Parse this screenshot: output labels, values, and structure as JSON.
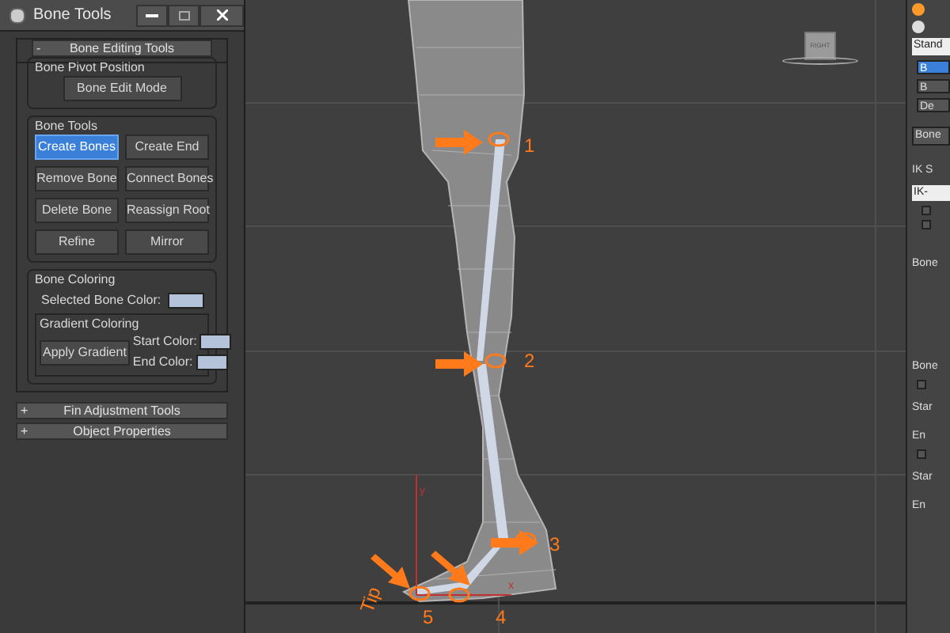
{
  "window": {
    "title": "Bone Tools"
  },
  "rollouts": [
    {
      "sign": "-",
      "title": "Bone Editing Tools"
    },
    {
      "sign": "+",
      "title": "Fin Adjustment Tools"
    },
    {
      "sign": "+",
      "title": "Object Properties"
    }
  ],
  "pivot_group": {
    "title": "Bone Pivot Position",
    "button": "Bone Edit Mode"
  },
  "bone_tools": {
    "title": "Bone Tools",
    "buttons": [
      {
        "label": "Create Bones",
        "selected": true
      },
      {
        "label": "Create End",
        "selected": false
      },
      {
        "label": "Remove Bone",
        "selected": false
      },
      {
        "label": "Connect Bones",
        "selected": false
      },
      {
        "label": "Delete Bone",
        "selected": false
      },
      {
        "label": "Reassign Root",
        "selected": false
      },
      {
        "label": "Refine",
        "selected": false
      },
      {
        "label": "Mirror",
        "selected": false
      }
    ]
  },
  "bone_coloring": {
    "title": "Bone Coloring",
    "selected_label": "Selected Bone Color:",
    "gradient": {
      "title": "Gradient Coloring",
      "button": "Apply Gradient",
      "start_label": "Start Color:",
      "end_label": "End Color:"
    }
  },
  "viewport": {
    "view_cube": "RIGHT",
    "axis_y": "y",
    "axis_x": "x",
    "annotations": [
      {
        "text": "1"
      },
      {
        "text": "2"
      },
      {
        "text": "3"
      },
      {
        "text": "Tip"
      },
      {
        "text": "5"
      },
      {
        "text": "4"
      }
    ]
  },
  "command_panel": {
    "dropdown": "Stand",
    "items": [
      {
        "label": "B",
        "selected": true
      },
      {
        "label": "B",
        "selected": false
      },
      {
        "label": "De",
        "selected": false
      }
    ],
    "field": "Bone",
    "ik_label": "IK S",
    "ik_field": "IK-",
    "checkboxes": [
      {
        "checked": false
      },
      {
        "checked": false
      }
    ],
    "group_1": "Bone",
    "group_2": "Bone",
    "bone_checkbox": {
      "checked": false
    },
    "labels": [
      "Star",
      "En",
      "Star",
      "En"
    ],
    "bottom_checkbox": {
      "checked": false
    }
  }
}
